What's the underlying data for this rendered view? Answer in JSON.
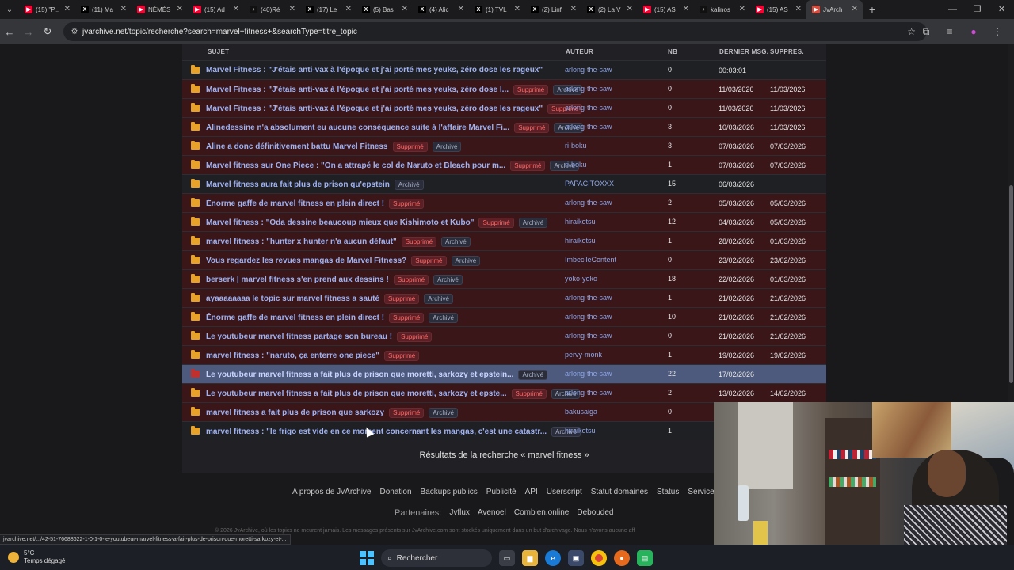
{
  "browser": {
    "tabs": [
      {
        "title": "(15) \"P...",
        "icon": "youtube-icon",
        "color": "#ff0033"
      },
      {
        "title": "(11) Ma",
        "icon": "x-icon",
        "color": "#000000"
      },
      {
        "title": "NÉMÉS",
        "icon": "youtube-icon",
        "color": "#ff0033"
      },
      {
        "title": "(15) Ad",
        "icon": "youtube-icon",
        "color": "#ff0033"
      },
      {
        "title": "(40)Ré",
        "icon": "tiktok-icon",
        "color": "#111111"
      },
      {
        "title": "(17) Le",
        "icon": "x-icon",
        "color": "#000000"
      },
      {
        "title": "(5) Bas",
        "icon": "x-icon",
        "color": "#000000"
      },
      {
        "title": "(4) Alic",
        "icon": "x-icon",
        "color": "#000000"
      },
      {
        "title": "(1) TVL",
        "icon": "x-icon",
        "color": "#000000"
      },
      {
        "title": "(2) Linf",
        "icon": "x-icon",
        "color": "#000000"
      },
      {
        "title": "(2) La V",
        "icon": "x-icon",
        "color": "#000000"
      },
      {
        "title": "(15) AS",
        "icon": "youtube-icon",
        "color": "#ff0033"
      },
      {
        "title": "kalinos",
        "icon": "tiktok-icon",
        "color": "#111111"
      },
      {
        "title": "(15) AS",
        "icon": "youtube-icon",
        "color": "#ff0033"
      },
      {
        "title": "JvArch",
        "icon": "jvarchive-icon",
        "color": "#e04a3a"
      }
    ],
    "url": "jvarchive.net/topic/recherche?search=marvel+fitness+&searchType=titre_topic",
    "status_url": "jvarchive.net/.../42-51-76688622-1-0-1-0-le-youtubeur-marvel-fitness-a-fait-plus-de-prison-que-moretti-sarkozy-et-..."
  },
  "table": {
    "headers": {
      "subject": "SUJET",
      "author": "AUTEUR",
      "nb": "NB",
      "last": "DERNIER MSG.",
      "deleted": "SUPPRES."
    },
    "badge_deleted": "Supprimé",
    "badge_archived": "Archivé",
    "rows": [
      {
        "subject": "Marvel Fitness : \"J'étais anti-vax à l'époque et j'ai porté mes yeuks, zéro dose les rageux\"",
        "sup": false,
        "arc": false,
        "author": "arlong-the-saw",
        "nb": "0",
        "last": "00:03:01",
        "deleted": "",
        "style": "plain",
        "icon": "orange"
      },
      {
        "subject": "Marvel Fitness : \"J'étais anti-vax à l'époque et j'ai porté mes yeuks, zéro dose l...",
        "sup": true,
        "arc": true,
        "author": "arlong-the-saw",
        "nb": "0",
        "last": "11/03/2026",
        "deleted": "11/03/2026",
        "style": "del",
        "icon": "orange"
      },
      {
        "subject": "Marvel Fitness : \"J'étais anti-vax à l'époque et j'ai porté mes yeuks, zéro dose les rageux\"",
        "sup": true,
        "arc": false,
        "author": "arlong-the-saw",
        "nb": "0",
        "last": "11/03/2026",
        "deleted": "11/03/2026",
        "style": "del",
        "icon": "orange"
      },
      {
        "subject": "Alinedessine n'a absolument eu aucune conséquence suite à l'affaire Marvel Fi...",
        "sup": true,
        "arc": true,
        "author": "arlong-the-saw",
        "nb": "3",
        "last": "10/03/2026",
        "deleted": "11/03/2026",
        "style": "del",
        "icon": "orange"
      },
      {
        "subject": "Aline a donc définitivement battu Marvel Fitness",
        "sup": true,
        "arc": true,
        "author": "ri-boku",
        "nb": "3",
        "last": "07/03/2026",
        "deleted": "07/03/2026",
        "style": "del",
        "icon": "orange"
      },
      {
        "subject": "Marvel fitness sur One Piece : \"On a attrapé le col de Naruto et Bleach pour m...",
        "sup": true,
        "arc": true,
        "author": "ri-boku",
        "nb": "1",
        "last": "07/03/2026",
        "deleted": "07/03/2026",
        "style": "del",
        "icon": "orange"
      },
      {
        "subject": "Marvel fitness aura fait plus de prison qu'epstein",
        "sup": false,
        "arc": true,
        "author": "PAPACITOXXX",
        "nb": "15",
        "last": "06/03/2026",
        "deleted": "",
        "style": "plain",
        "icon": "orange"
      },
      {
        "subject": "Énorme gaffe de marvel fitness en plein direct !",
        "sup": true,
        "arc": false,
        "author": "arlong-the-saw",
        "nb": "2",
        "last": "05/03/2026",
        "deleted": "05/03/2026",
        "style": "del",
        "icon": "orange"
      },
      {
        "subject": "Marvel fitness : \"Oda dessine beaucoup mieux que Kishimoto et Kubo\"",
        "sup": true,
        "arc": true,
        "author": "hiraikotsu",
        "nb": "12",
        "last": "04/03/2026",
        "deleted": "05/03/2026",
        "style": "del",
        "icon": "orange"
      },
      {
        "subject": "marvel fitness : \"hunter x hunter n'a aucun défaut\"",
        "sup": true,
        "arc": true,
        "author": "hiraikotsu",
        "nb": "1",
        "last": "28/02/2026",
        "deleted": "01/03/2026",
        "style": "del",
        "icon": "orange"
      },
      {
        "subject": "Vous regardez les revues mangas de Marvel Fitness?",
        "sup": true,
        "arc": true,
        "author": "ImbecileContent",
        "nb": "0",
        "last": "23/02/2026",
        "deleted": "23/02/2026",
        "style": "del",
        "icon": "orange"
      },
      {
        "subject": "berserk | marvel fitness s'en prend aux dessins !",
        "sup": true,
        "arc": true,
        "author": "yoko-yoko",
        "nb": "18",
        "last": "22/02/2026",
        "deleted": "01/03/2026",
        "style": "del",
        "icon": "orange"
      },
      {
        "subject": "ayaaaaaaaa le topic sur marvel fitness a sauté",
        "sup": true,
        "arc": true,
        "author": "arlong-the-saw",
        "nb": "1",
        "last": "21/02/2026",
        "deleted": "21/02/2026",
        "style": "del",
        "icon": "orange"
      },
      {
        "subject": "Énorme gaffe de marvel fitness en plein direct !",
        "sup": true,
        "arc": true,
        "author": "arlong-the-saw",
        "nb": "10",
        "last": "21/02/2026",
        "deleted": "21/02/2026",
        "style": "del",
        "icon": "orange"
      },
      {
        "subject": "Le youtubeur marvel fitness partage son bureau !",
        "sup": true,
        "arc": false,
        "author": "arlong-the-saw",
        "nb": "0",
        "last": "21/02/2026",
        "deleted": "21/02/2026",
        "style": "del",
        "icon": "orange"
      },
      {
        "subject": "marvel fitness : \"naruto, ça enterre one piece\"",
        "sup": true,
        "arc": false,
        "author": "pervy-monk",
        "nb": "1",
        "last": "19/02/2026",
        "deleted": "19/02/2026",
        "style": "del",
        "icon": "orange"
      },
      {
        "subject": "Le youtubeur marvel fitness a fait plus de prison que moretti, sarkozy et epstein...",
        "sup": false,
        "arc": true,
        "author": "arlong-the-saw",
        "nb": "22",
        "last": "17/02/2026",
        "deleted": "",
        "style": "hl",
        "icon": "red"
      },
      {
        "subject": "Le youtubeur marvel fitness a fait plus de prison que moretti, sarkozy et epste...",
        "sup": true,
        "arc": true,
        "author": "arlong-the-saw",
        "nb": "2",
        "last": "13/02/2026",
        "deleted": "14/02/2026",
        "style": "del",
        "icon": "orange"
      },
      {
        "subject": "marvel fitness a fait plus de prison que sarkozy",
        "sup": true,
        "arc": true,
        "author": "bakusaiga",
        "nb": "0",
        "last": "",
        "deleted": "",
        "style": "del",
        "icon": "orange"
      },
      {
        "subject": "marvel fitness : \"le frigo est vide en ce moment concernant les mangas, c'est une catastr...",
        "sup": false,
        "arc": true,
        "author": "hiraikotsu",
        "nb": "1",
        "last": "",
        "deleted": "",
        "style": "plain",
        "icon": "orange"
      }
    ]
  },
  "results_title": "Résultats de la recherche « marvel fitness »",
  "footer": {
    "links": [
      "A propos de JvArchive",
      "Donation",
      "Backups publics",
      "Publicité",
      "API",
      "Userscript",
      "Statut domaines",
      "Status",
      "Service Tor"
    ],
    "partners_label": "Partenaires:",
    "partners": [
      "Jvflux",
      "Avenoel",
      "Combien.online",
      "Debouded"
    ],
    "copyright": "© 2026 JvArchive, où les topics ne meurent jamais. Les messages présents sur JvArchive.com sont stockés uniquement dans un but d'archivage. Nous n'avons aucune aff"
  },
  "taskbar": {
    "temp": "5°C",
    "weather": "Temps dégagé",
    "search": "Rechercher"
  }
}
